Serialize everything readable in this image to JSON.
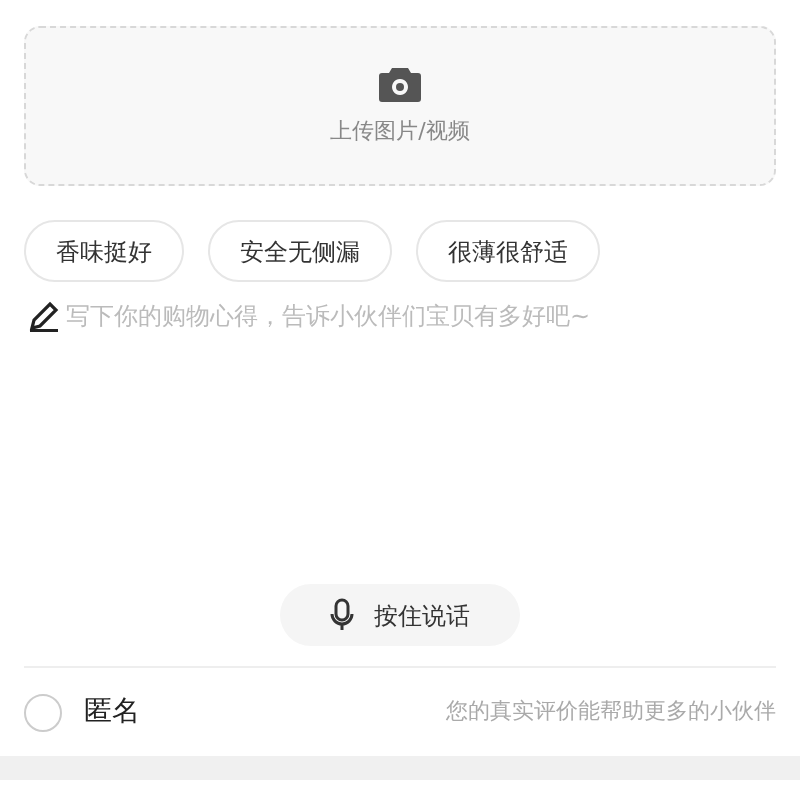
{
  "upload": {
    "label": "上传图片/视频"
  },
  "tags": [
    {
      "label": "香味挺好",
      "selected": false
    },
    {
      "label": "安全无侧漏",
      "selected": false
    },
    {
      "label": "很薄很舒适",
      "selected": false
    }
  ],
  "review": {
    "placeholder": "写下你的购物心得，告诉小伙伴们宝贝有多好吧~"
  },
  "voice_button": "按住说话",
  "anonymous": {
    "label": "匿名",
    "checked": false,
    "hint": "您的真实评价能帮助更多的小伙伴"
  }
}
